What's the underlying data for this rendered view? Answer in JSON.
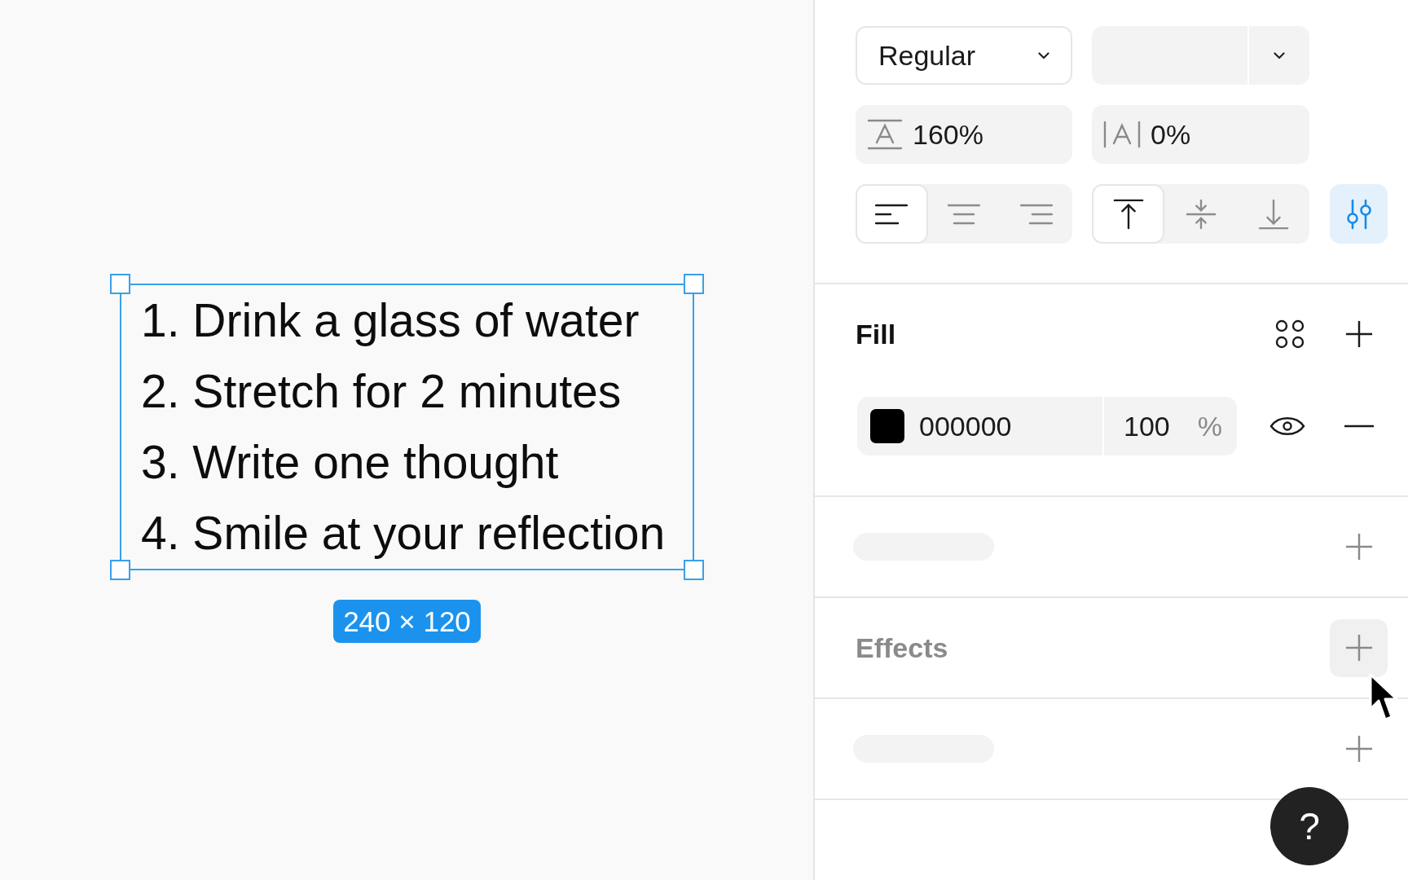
{
  "canvas": {
    "text_box": {
      "selected": true,
      "lines": [
        "1. Drink a glass of water",
        "2. Stretch for 2 minutes",
        "3. Write one thought",
        "4. Smile at your reflection"
      ],
      "size_badge": "240 × 120"
    }
  },
  "typography": {
    "font_weight": {
      "value": "Regular"
    },
    "line_height": {
      "value": "160%"
    },
    "letter_spacing": {
      "value": "0%"
    },
    "text_align": [
      {
        "kind": "left",
        "selected": true
      },
      {
        "kind": "center",
        "selected": false
      },
      {
        "kind": "right",
        "selected": false
      }
    ],
    "vertical_align": [
      {
        "kind": "top",
        "selected": true
      },
      {
        "kind": "middle",
        "selected": false
      },
      {
        "kind": "bottom",
        "selected": false
      }
    ],
    "type_settings": {
      "on": true
    }
  },
  "sections": [
    {
      "kind": "fill",
      "title": "Fill",
      "active": true,
      "add_hovered": false,
      "items": [
        {
          "color": "#000000",
          "hex": "000000",
          "opacity": "100",
          "unit": "%",
          "visible": true
        }
      ]
    },
    {
      "kind": "loading"
    },
    {
      "kind": "effects",
      "title": "Effects",
      "active": false,
      "add_hovered": true
    },
    {
      "kind": "loading"
    }
  ],
  "help_button": {
    "label": "?"
  }
}
